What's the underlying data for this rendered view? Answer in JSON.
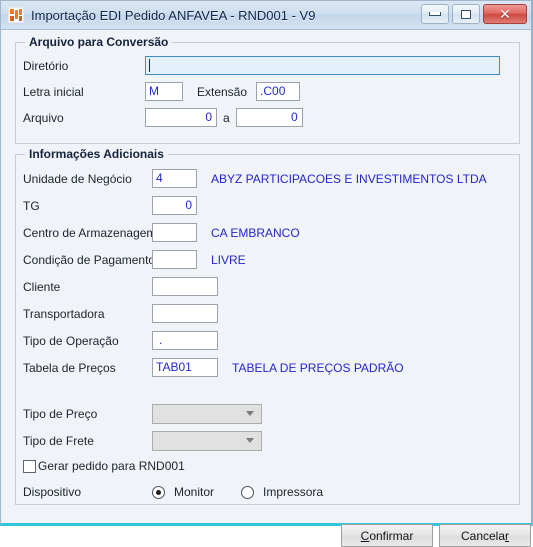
{
  "window": {
    "title": "Importação EDI Pedido ANFAVEA - RND001 - V9",
    "icon": "app-icon",
    "controls": {
      "minimize": "minimize-button",
      "maximize": "maximize-button",
      "close_glyph": "✕"
    }
  },
  "group_conversion": {
    "legend": "Arquivo para Conversão",
    "directory": {
      "label": "Diretório",
      "value": "",
      "focused": true
    },
    "initial_letter": {
      "label": "Letra inicial",
      "value": "M"
    },
    "extension": {
      "label": "Extensão",
      "value": ".C00"
    },
    "file": {
      "label": "Arquivo",
      "from": "0",
      "separator": "a",
      "to": "0"
    }
  },
  "group_additional": {
    "legend": "Informações Adicionais",
    "fields": [
      {
        "label": "Unidade de Negócio",
        "value": "4",
        "description": "ABYZ PARTICIPACOES E INVESTIMENTOS LTDA"
      },
      {
        "label": "TG",
        "value": "0",
        "description": ""
      },
      {
        "label": "Centro de Armazenagem",
        "value": "",
        "description": "CA EMBRANCO"
      },
      {
        "label": "Condição de Pagamento",
        "value": "",
        "description": "LIVRE"
      },
      {
        "label": "Cliente",
        "value": "",
        "description": ""
      },
      {
        "label": "Transportadora",
        "value": "",
        "description": ""
      },
      {
        "label": "Tipo de Operação",
        "value": ".",
        "description": ""
      },
      {
        "label": "Tabela de Preços",
        "value": "TAB01",
        "description": "TABELA DE PREÇOS PADRÃO"
      }
    ],
    "price_type": {
      "label": "Tipo de Preço",
      "value": ""
    },
    "freight_type": {
      "label": "Tipo de Frete",
      "value": ""
    },
    "generate_order": {
      "label": "Gerar pedido para RND001",
      "checked": false
    },
    "device": {
      "label": "Dispositivo",
      "options": [
        {
          "label": "Monitor",
          "selected": true
        },
        {
          "label": "Impressora",
          "selected": false
        }
      ]
    }
  },
  "footer": {
    "confirm": {
      "pre": "",
      "accel": "C",
      "post": "onfirmar"
    },
    "cancel": {
      "pre": "Cancela",
      "accel": "r",
      "post": ""
    }
  }
}
